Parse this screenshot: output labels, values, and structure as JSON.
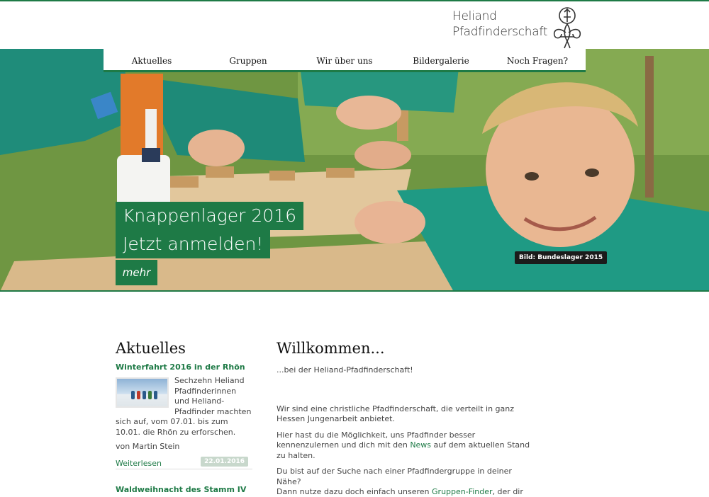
{
  "header": {
    "logo_line1": "Heliand",
    "logo_line2": "Pfadfinderschaft"
  },
  "nav": {
    "items": [
      "Aktuelles",
      "Gruppen",
      "Wir über uns",
      "Bildergalerie",
      "Noch Fragen?"
    ]
  },
  "hero": {
    "teaser_line1": "Knappenlager 2016",
    "teaser_line2": "Jetzt anmelden!",
    "more_label": "mehr",
    "caption": "Bild: Bundeslager 2015"
  },
  "sidebar": {
    "heading": "Aktuelles",
    "news": [
      {
        "title": "Winterfahrt 2016 in der Rhön",
        "text": "Sechzehn Heliand Pfadfinderinnen und Heliand-Pfadfinder machten sich auf, vom 07.01. bis zum 10.01. die Rhön zu erforschen.",
        "author": "von Martin Stein",
        "more": "Weiterlesen",
        "date": "22.01.2016"
      },
      {
        "title": "Waldweihnacht des Stamm IV"
      }
    ]
  },
  "main": {
    "heading": "Willkommen...",
    "lead": "...bei der Heliand-Pfadfinderschaft!",
    "p1": "Wir sind eine christliche Pfadfinderschaft, die verteilt in ganz Hessen Jungenarbeit anbietet.",
    "p2_before": "Hier hast du die Möglichkeit, uns Pfadfinder besser kennenzulernen und dich mit den ",
    "p2_link": "News",
    "p2_after": " auf dem aktuellen Stand zu halten.",
    "p3_line1": "Du bist auf der Suche nach einer Pfadfindergruppe in deiner Nähe?",
    "p3_before": "Dann nutze dazu doch einfach unseren ",
    "p3_link": "Gruppen-Finder",
    "p3_after": ", der dir direkt anzeigt, wo wir Heliand-Pfadfinder zu finden sind!"
  },
  "colors": {
    "accent": "#1e7a46",
    "date_badge": "#c8d8cc",
    "caption_bg": "#1b1b1b"
  }
}
